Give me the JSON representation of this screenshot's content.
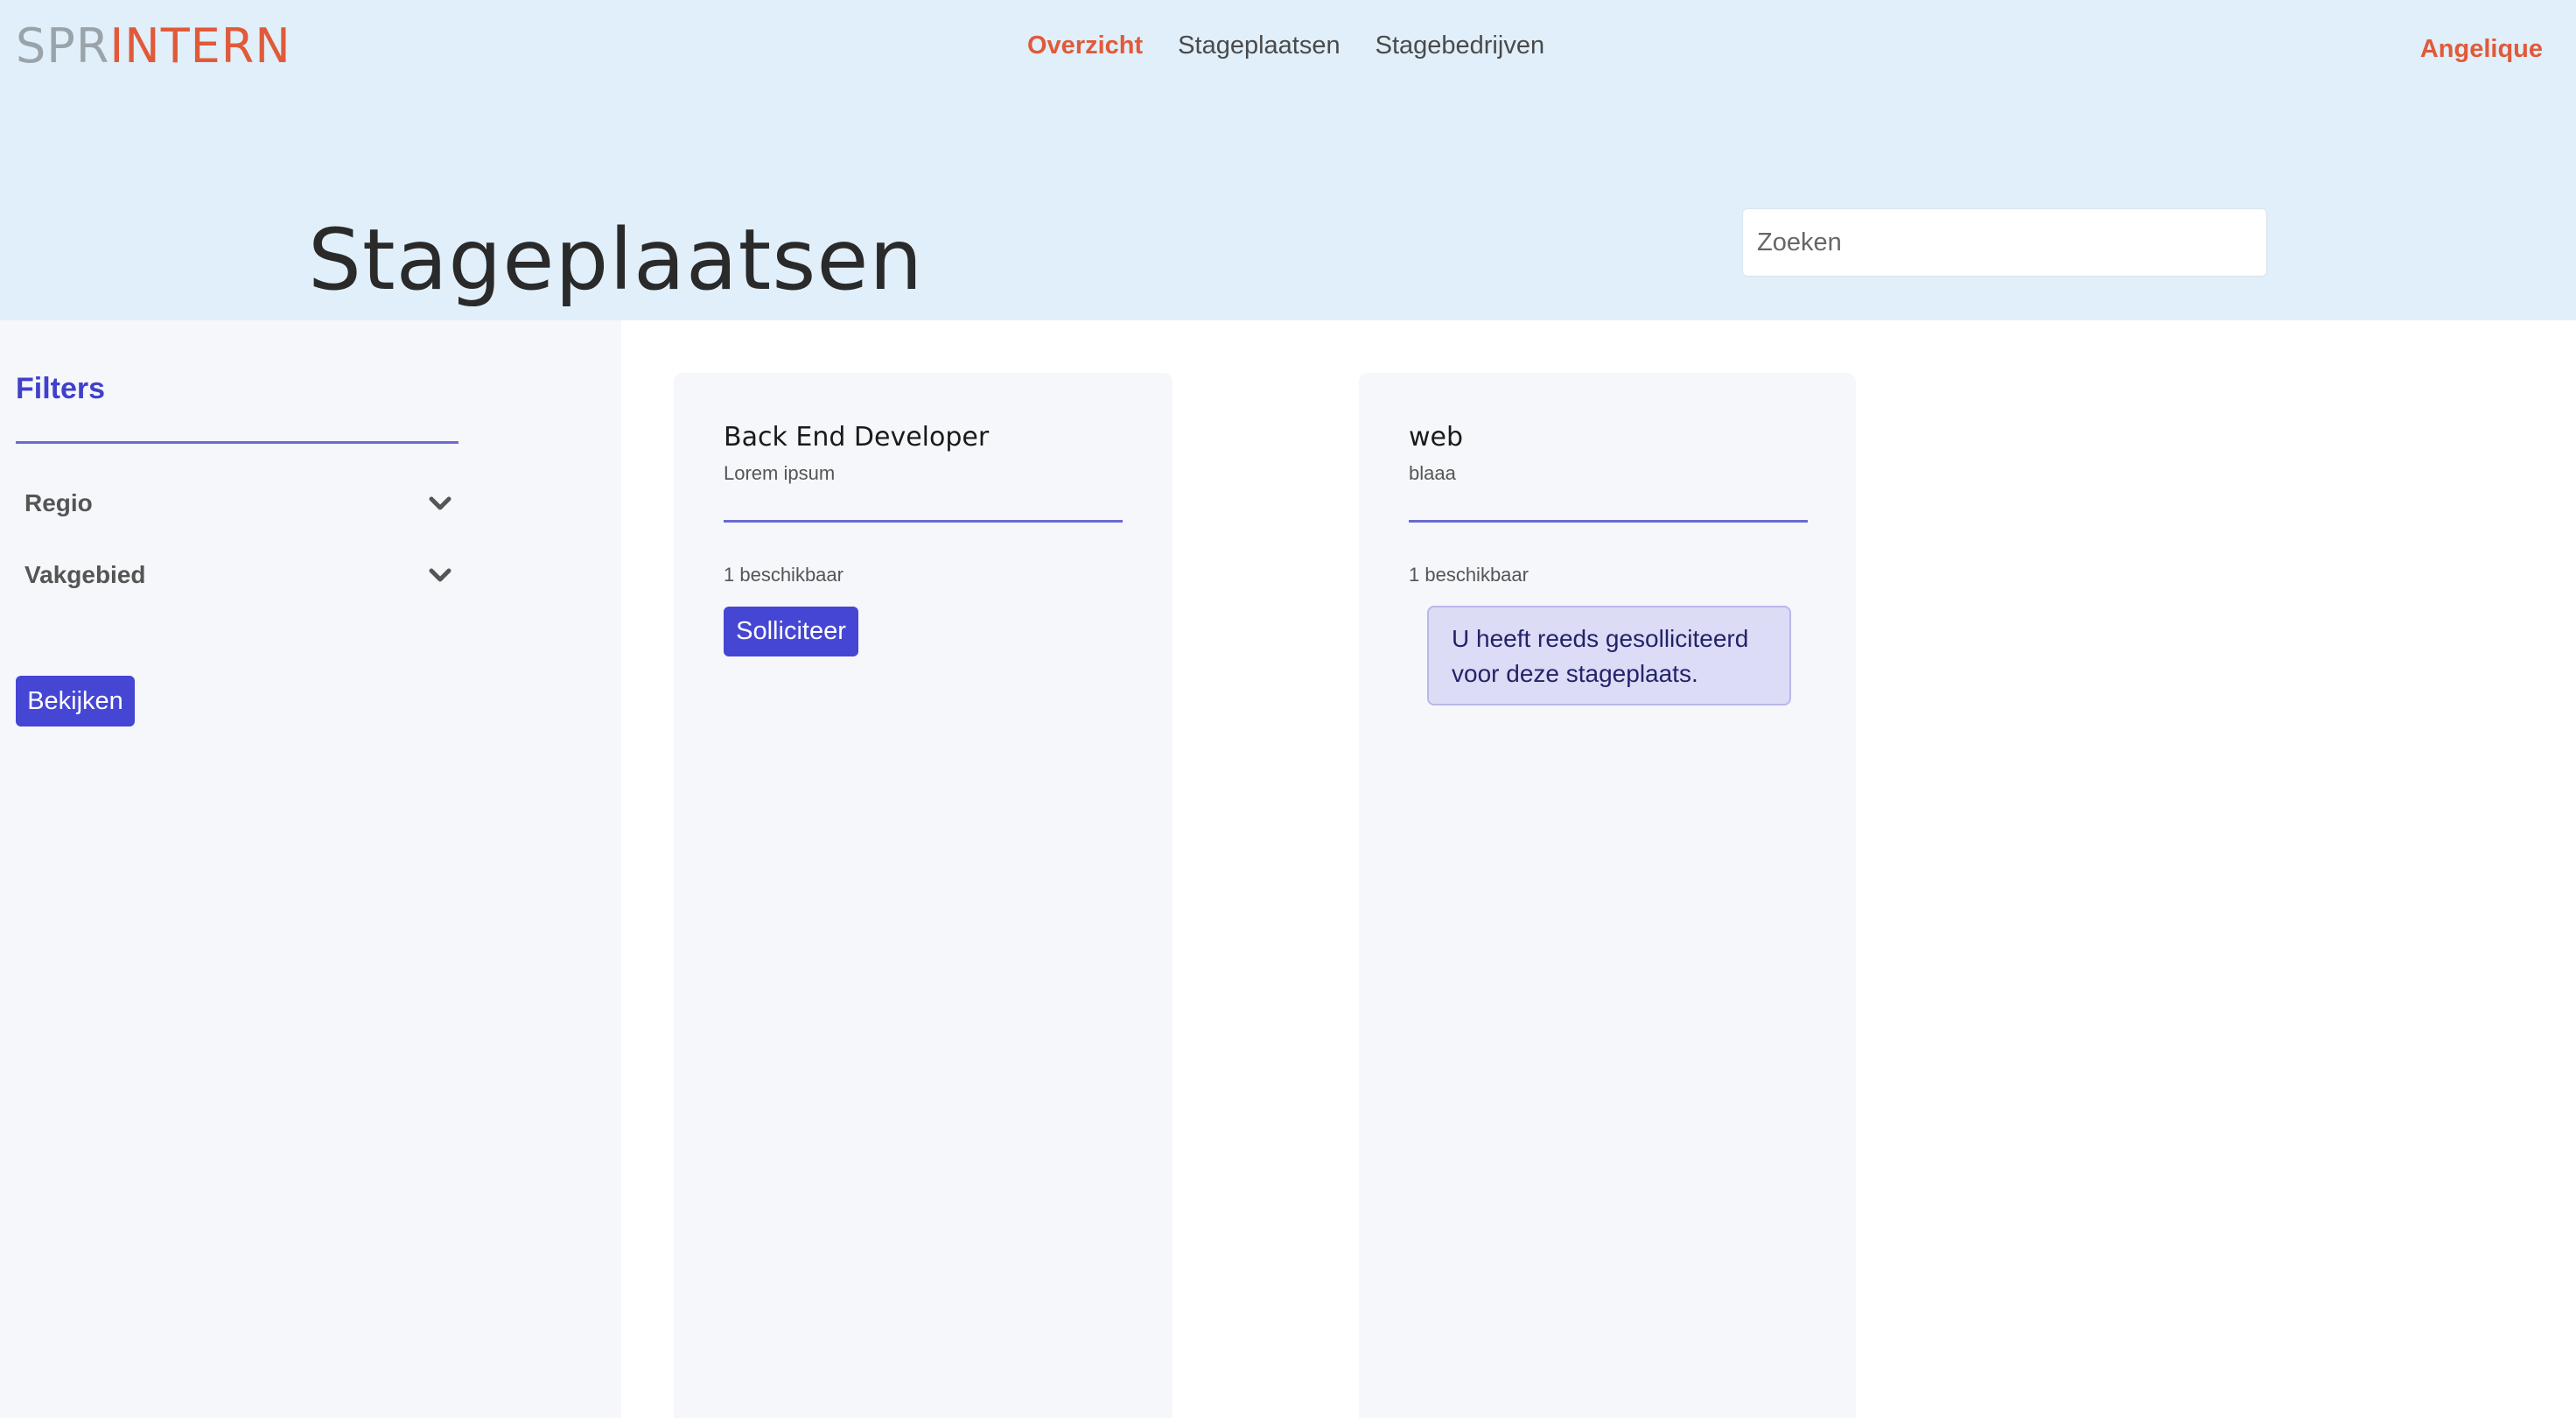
{
  "header": {
    "logo_part1": "SPR",
    "logo_part2": "INTERN",
    "nav": [
      {
        "label": "Overzicht",
        "active": true
      },
      {
        "label": "Stageplaatsen",
        "active": false
      },
      {
        "label": "Stagebedrijven",
        "active": false
      }
    ],
    "user_name": "Angelique",
    "page_title": "Stageplaatsen",
    "search": {
      "placeholder": "Zoeken",
      "value": ""
    }
  },
  "sidebar": {
    "title": "Filters",
    "filters": [
      {
        "label": "Regio",
        "icon": "chevron-down-icon"
      },
      {
        "label": "Vakgebied",
        "icon": "chevron-down-icon"
      }
    ],
    "submit_label": "Bekijken"
  },
  "cards": [
    {
      "title": "Back End Developer",
      "subtitle": "Lorem ipsum",
      "available": "1 beschikbaar",
      "action_label": "Solliciteer"
    },
    {
      "title": "web",
      "subtitle": "blaaa",
      "available": "1 beschikbaar",
      "notice": "U heeft reeds gesolliciteerd voor deze stageplaats."
    }
  ],
  "colors": {
    "header_bg": "#e0eff9",
    "accent_orange": "#e05a3a",
    "primary_blue": "#4646d4",
    "panel_bg": "#f5f7fb",
    "notice_bg": "#dcdcf6"
  }
}
